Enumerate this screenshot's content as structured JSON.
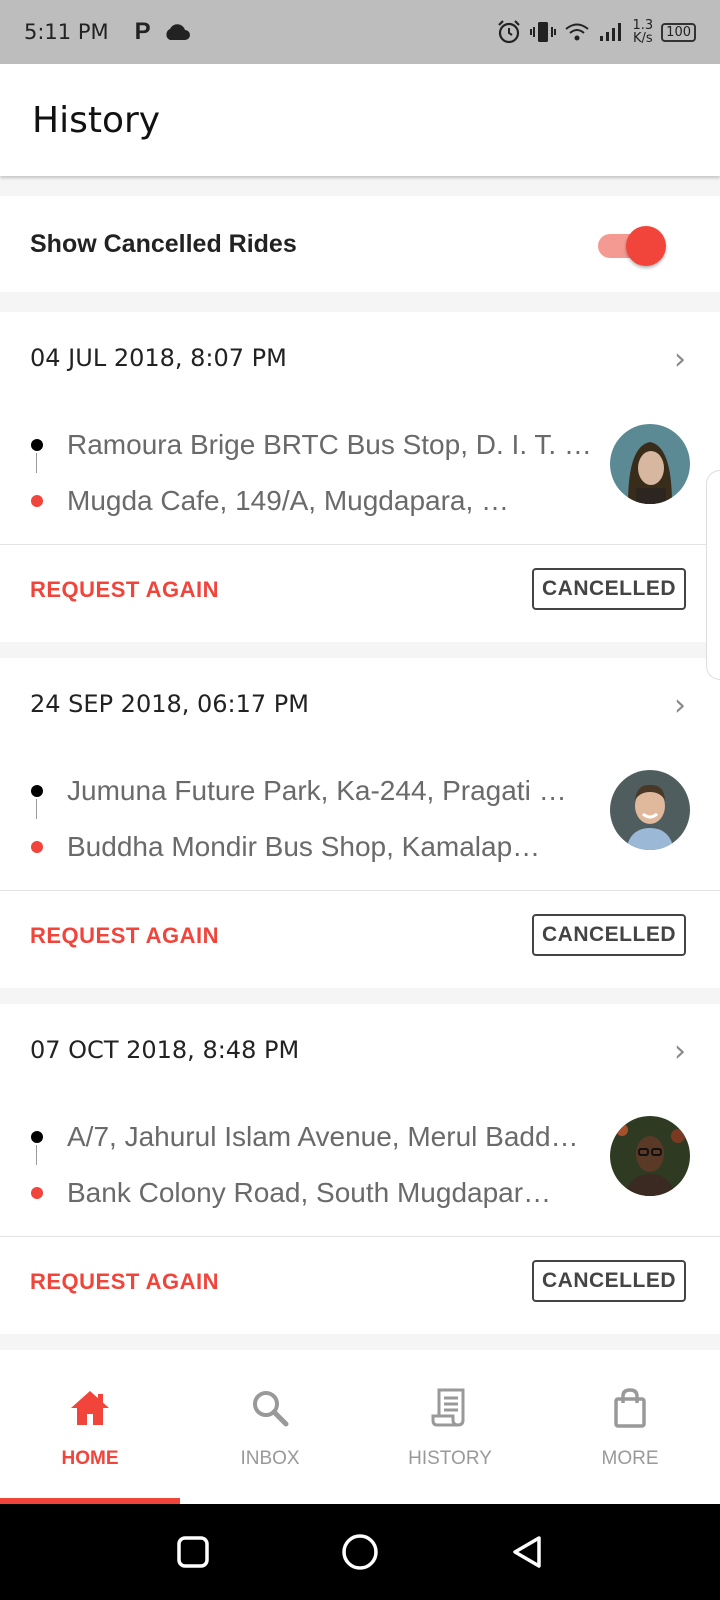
{
  "status_bar": {
    "time": "5:11 PM",
    "speed_value": "1.3",
    "speed_unit": "K/s",
    "battery": "100",
    "icons": [
      "parking-icon",
      "cloud-icon",
      "alarm-icon",
      "vibrate-icon",
      "wifi-icon",
      "signal-icon"
    ]
  },
  "app_bar": {
    "title": "History"
  },
  "filter": {
    "label": "Show Cancelled Rides",
    "enabled": true
  },
  "colors": {
    "accent": "#f1443a",
    "accent_light": "#f49a92"
  },
  "rides": [
    {
      "date": "04 JUL 2018, 8:07 PM",
      "pickup": "Ramoura Brige BRTC Bus Stop, D. I. T. …",
      "dropoff": "Mugda Cafe, 149/A, Mugdapara, …",
      "action": "REQUEST AGAIN",
      "status": "CANCELLED"
    },
    {
      "date": "24 SEP 2018, 06:17 PM",
      "pickup": "Jumuna Future Park, Ka-244, Pragati …",
      "dropoff": "Buddha Mondir Bus Shop, Kamalap…",
      "action": "REQUEST AGAIN",
      "status": "CANCELLED"
    },
    {
      "date": "07 OCT 2018, 8:48 PM",
      "pickup": "A/7, Jahurul Islam Avenue, Merul Badd…",
      "dropoff": "Bank Colony Road, South Mugdapar…",
      "action": "REQUEST AGAIN",
      "status": "CANCELLED"
    }
  ],
  "bottom_nav": [
    {
      "label": "HOME",
      "icon": "home-icon",
      "active": true
    },
    {
      "label": "INBOX",
      "icon": "search-icon",
      "active": false
    },
    {
      "label": "HISTORY",
      "icon": "receipt-icon",
      "active": false
    },
    {
      "label": "MORE",
      "icon": "bag-icon",
      "active": false
    }
  ]
}
